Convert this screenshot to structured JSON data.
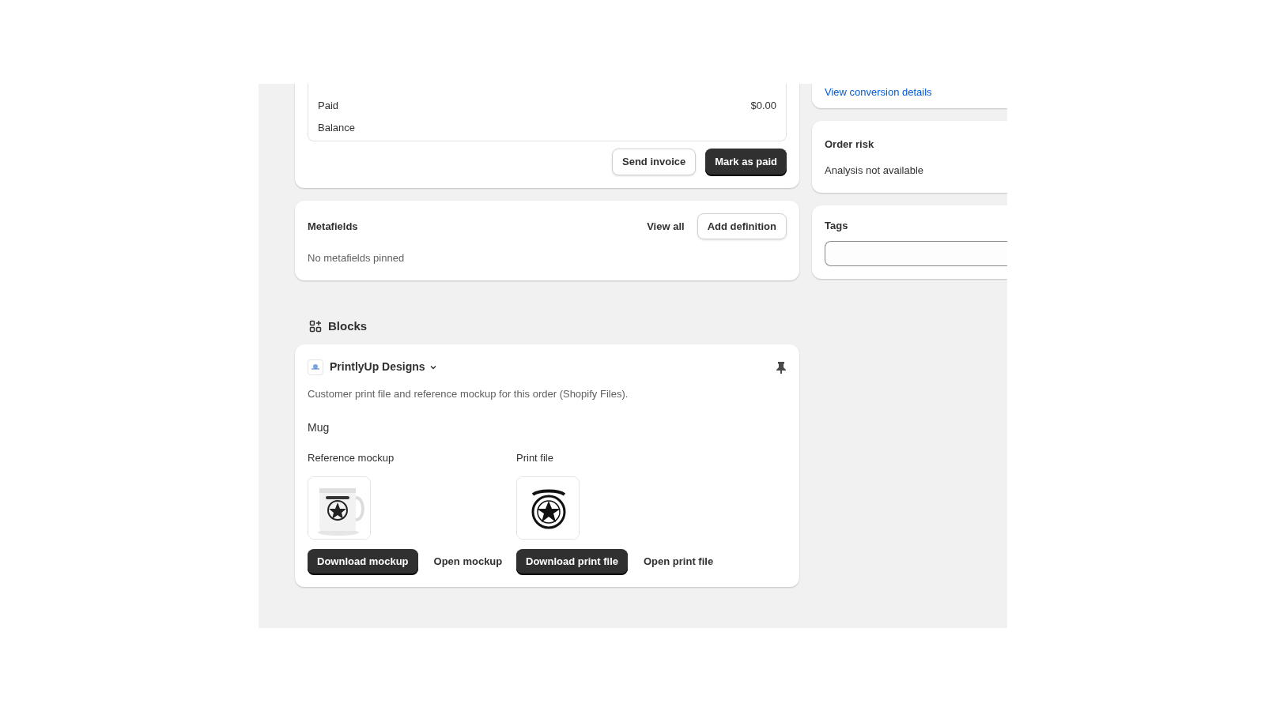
{
  "payment": {
    "rows": [
      {
        "label": "Paid",
        "value": "$0.00"
      },
      {
        "label": "Balance",
        "value": ""
      }
    ],
    "buttons": [
      {
        "label": "Send invoice",
        "kind": "secondary"
      },
      {
        "label": "Mark as paid",
        "kind": "primary"
      }
    ]
  },
  "metafields": {
    "title": "Metafields",
    "link": "View all",
    "button": "Add definition",
    "empty": "No metafields pinned"
  },
  "blocks": {
    "heading": "Blocks",
    "app": {
      "name": "PrintlyUp Designs",
      "description": "Customer print file and reference mockup for this order (Shopify Files).",
      "product": "Mug",
      "files": [
        {
          "label": "Reference mockup",
          "kind": "mug",
          "download": "Download mockup",
          "open": "Open mockup"
        },
        {
          "label": "Print file",
          "kind": "print",
          "download": "Download print file",
          "open": "Open print file"
        }
      ]
    }
  },
  "sidebar": {
    "conversion_link": "View conversion details",
    "order_risk": {
      "title": "Order risk",
      "text": "Analysis not available"
    },
    "tags": {
      "title": "Tags"
    }
  }
}
